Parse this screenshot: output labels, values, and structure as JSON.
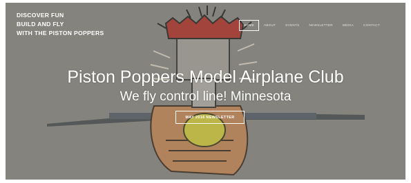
{
  "brand": {
    "line1": "DISCOVER FUN",
    "line2": "BUILD AND FLY",
    "line3": "WITH THE PISTON POPPERS"
  },
  "nav": {
    "items": [
      {
        "label": "HOME",
        "active": true
      },
      {
        "label": "ABOUT",
        "active": false
      },
      {
        "label": "EVENTS",
        "active": false
      },
      {
        "label": "NEWSLETTER",
        "active": false
      },
      {
        "label": "MEDIA",
        "active": false
      },
      {
        "label": "CONTACT",
        "active": false
      }
    ]
  },
  "hero": {
    "title": "Piston Poppers Model Airplane Club",
    "subtitle": "We fly control line!  Minnesota",
    "cta_label": "MAY 2016 NEWSLETTER"
  },
  "colors": {
    "background": "#8c8b86",
    "text": "#ffffff",
    "artwork_red": "#c0392b",
    "artwork_yellow": "#e2d93a",
    "artwork_skin": "#d39a63"
  }
}
